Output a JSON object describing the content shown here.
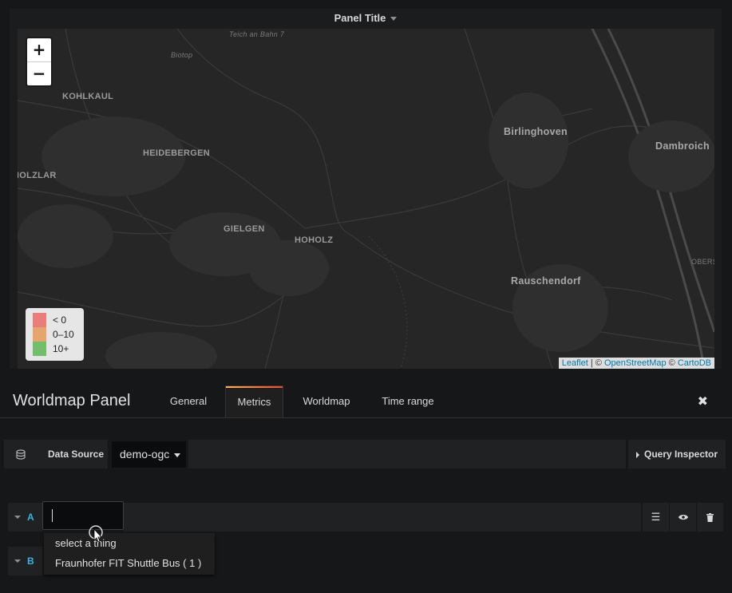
{
  "panel": {
    "title": "Panel Title"
  },
  "map": {
    "zoom_in": "+",
    "zoom_out": "−",
    "places": [
      "Teich an Bahn 7",
      "Biotop",
      "KOHLKAUL",
      "HEIDEBERGEN",
      "HOLZLAR",
      "GIELGEN",
      "HOHOLZ",
      "Birlinghoven",
      "Dambroich",
      "Rauschendorf",
      "OBERS"
    ],
    "legend": [
      {
        "label": "< 0",
        "color": "#ea7d7a"
      },
      {
        "label": "0–10",
        "color": "#e6a46f"
      },
      {
        "label": "10+",
        "color": "#73bf69"
      }
    ],
    "attribution": {
      "leaflet": "Leaflet",
      "sep1": " | © ",
      "osm": "OpenStreetMap",
      "sep2": " © ",
      "carto": "CartoDB"
    }
  },
  "editor": {
    "title": "Worldmap Panel",
    "tabs": [
      "General",
      "Metrics",
      "Worldmap",
      "Time range"
    ],
    "active_tab": "Metrics",
    "close": "✖"
  },
  "datasource": {
    "label": "Data Source",
    "value": "demo-ogc",
    "query_inspector": "Query Inspector"
  },
  "queries": [
    {
      "letter": "A",
      "value": ""
    },
    {
      "letter": "B"
    }
  ],
  "dropdown": {
    "items": [
      "select a thing",
      "Fraunhofer FIT Shuttle Bus ( 1 )"
    ]
  }
}
